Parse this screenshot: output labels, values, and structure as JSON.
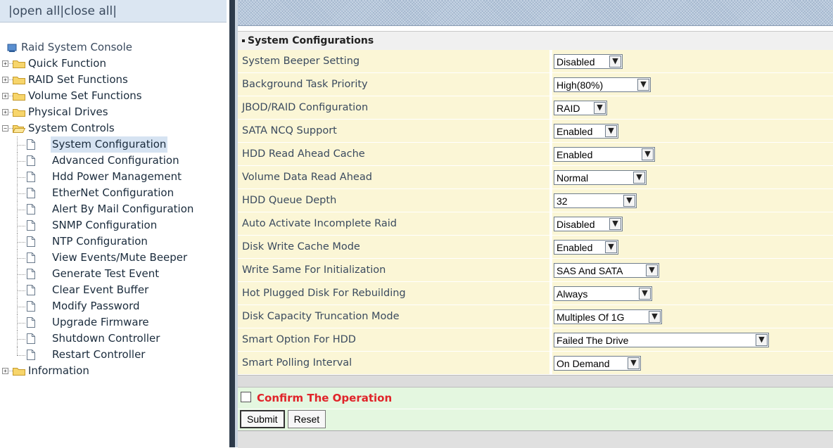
{
  "nav": {
    "open_all": "|open all",
    "close_all": "|close all|"
  },
  "tree": {
    "root": "Raid System Console",
    "folders": [
      {
        "label": "Quick Function"
      },
      {
        "label": "RAID Set Functions"
      },
      {
        "label": "Volume Set Functions"
      },
      {
        "label": "Physical Drives"
      },
      {
        "label": "System Controls"
      }
    ],
    "system_controls_items": [
      {
        "label": "System Configuration"
      },
      {
        "label": "Advanced Configuration"
      },
      {
        "label": "Hdd Power Management"
      },
      {
        "label": "EtherNet Configuration"
      },
      {
        "label": "Alert By Mail Configuration"
      },
      {
        "label": "SNMP Configuration"
      },
      {
        "label": "NTP Configuration"
      },
      {
        "label": "View Events/Mute Beeper"
      },
      {
        "label": "Generate Test Event"
      },
      {
        "label": "Clear Event Buffer"
      },
      {
        "label": "Modify Password"
      },
      {
        "label": "Upgrade Firmware"
      },
      {
        "label": "Shutdown Controller"
      },
      {
        "label": "Restart Controller"
      }
    ],
    "information": "Information"
  },
  "panel": {
    "title": "System Configurations",
    "rows": [
      {
        "label": "System Beeper Setting",
        "value": "Disabled"
      },
      {
        "label": "Background Task Priority",
        "value": "High(80%)"
      },
      {
        "label": "JBOD/RAID Configuration",
        "value": "RAID"
      },
      {
        "label": "SATA NCQ Support",
        "value": "Enabled"
      },
      {
        "label": "HDD Read Ahead Cache",
        "value": "Enabled"
      },
      {
        "label": "Volume Data Read Ahead",
        "value": "Normal"
      },
      {
        "label": "HDD Queue Depth",
        "value": "32"
      },
      {
        "label": "Auto Activate Incomplete Raid",
        "value": "Disabled"
      },
      {
        "label": "Disk Write Cache Mode",
        "value": "Enabled"
      },
      {
        "label": "Write Same For Initialization",
        "value": "SAS And SATA"
      },
      {
        "label": "Hot Plugged Disk For Rebuilding",
        "value": "Always"
      },
      {
        "label": "Disk Capacity Truncation Mode",
        "value": "Multiples Of 1G"
      },
      {
        "label": "Smart Option For HDD",
        "value": "Failed The Drive"
      },
      {
        "label": "Smart Polling Interval",
        "value": "On Demand"
      }
    ],
    "confirm_label": "Confirm The Operation",
    "submit_label": "Submit",
    "reset_label": "Reset"
  }
}
